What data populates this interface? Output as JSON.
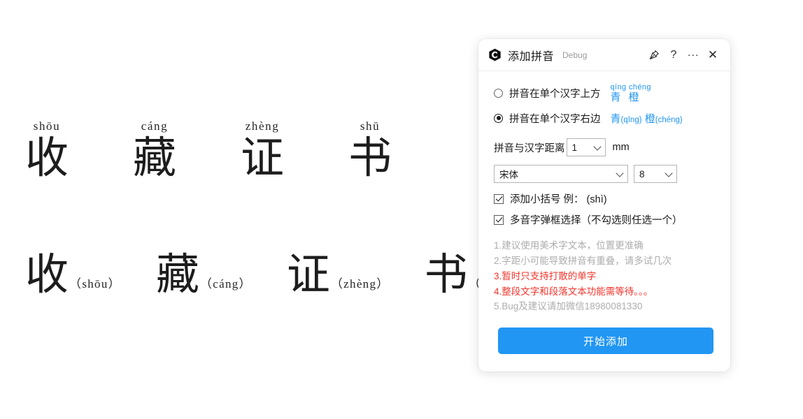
{
  "document": {
    "row_above": {
      "layout": "pinyin-above-character",
      "items": [
        {
          "hanzi": "收",
          "pinyin": "shōu"
        },
        {
          "hanzi": "藏",
          "pinyin": "cáng"
        },
        {
          "hanzi": "证",
          "pinyin": "zhèng"
        },
        {
          "hanzi": "书",
          "pinyin": "shū"
        }
      ]
    },
    "row_side": {
      "layout": "pinyin-right-of-character",
      "items": [
        {
          "hanzi": "收",
          "pinyin": "（shōu）"
        },
        {
          "hanzi": "藏",
          "pinyin": "（cáng）"
        },
        {
          "hanzi": "证",
          "pinyin": "（zhèng）"
        },
        {
          "hanzi": "书",
          "pinyin": "（shū）"
        }
      ]
    }
  },
  "panel": {
    "titlebar": {
      "logo_icon": "hexagon-c-logo-icon",
      "title": "添加拼音",
      "debug_label": "Debug",
      "pin_icon": "pin-icon",
      "help_icon": "question-mark-icon",
      "more_icon": "ellipsis-icon",
      "close_icon": "close-icon"
    },
    "options": {
      "accent_color": "#2196f3",
      "warn_color": "#f4352c",
      "radios": [
        {
          "label": "拼音在单个汉字上方",
          "selected": false,
          "preview_style": "above",
          "preview_pinyin": "qīng  chéng",
          "preview_hanzi": "青橙"
        },
        {
          "label": "拼音在单个汉字右边",
          "selected": true,
          "preview_style": "side",
          "preview_hanzi_1": "青",
          "preview_pinyin_1": "(qīng)",
          "preview_hanzi_2": "橙",
          "preview_pinyin_2": "(chéng)"
        }
      ],
      "distance": {
        "label": "拼音与汉字距离",
        "value": "1",
        "unit": "mm"
      },
      "font": {
        "family_value": "宋体",
        "size_value": "8"
      },
      "checkboxes": [
        {
          "label": "添加小括号  例：  (shì)",
          "checked": true
        },
        {
          "label": "多音字弹框选择（不勾选则任选一个）",
          "checked": true
        }
      ]
    },
    "notes": [
      {
        "text": "1.建议使用美术字文本，位置更准确",
        "warn": false
      },
      {
        "text": "2.字距小可能导致拼音有重叠，请多试几次",
        "warn": false
      },
      {
        "text": "3.暂时只支持打散的单字",
        "warn": true
      },
      {
        "text": "4.整段文字和段落文本功能需等待。。。",
        "warn": true
      },
      {
        "text": "5.Bug及建议请加微信18980081330",
        "warn": false
      }
    ],
    "primary_button": "开始添加"
  }
}
